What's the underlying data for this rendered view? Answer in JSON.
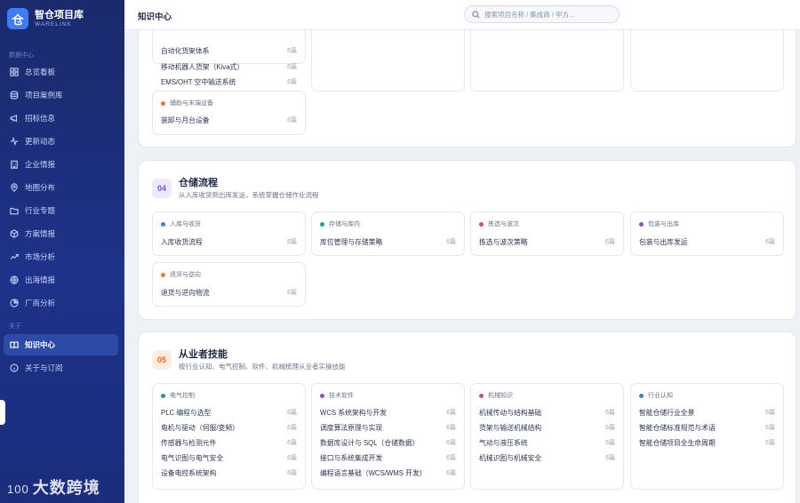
{
  "brand": {
    "logo": "仓",
    "name": "智仓项目库",
    "sub": "WARELINK"
  },
  "sidebar": {
    "group1": "数据中心",
    "group2": "关于",
    "items": [
      {
        "label": "总览看板",
        "icon": "dashboard-icon"
      },
      {
        "label": "项目案例库",
        "icon": "database-icon"
      },
      {
        "label": "招标信息",
        "icon": "megaphone-icon"
      },
      {
        "label": "更新动态",
        "icon": "activity-icon"
      },
      {
        "label": "企业情报",
        "icon": "building-icon"
      },
      {
        "label": "地图分布",
        "icon": "map-pin-icon"
      },
      {
        "label": "行业专题",
        "icon": "folder-icon"
      },
      {
        "label": "方案情报",
        "icon": "cube-icon"
      },
      {
        "label": "市场分析",
        "icon": "trend-icon"
      },
      {
        "label": "出海情报",
        "icon": "globe-icon"
      },
      {
        "label": "厂商分析",
        "icon": "pie-icon"
      }
    ],
    "items2": [
      {
        "label": "知识中心",
        "icon": "book-icon",
        "active": true
      },
      {
        "label": "关于与订阅",
        "icon": "info-icon"
      }
    ],
    "watermark_prefix": "100",
    "watermark": "大数跨境"
  },
  "header": {
    "title": "知识中心",
    "search_placeholder": "搜索项目名称 / 集成商 / 甲方..."
  },
  "colors": {
    "accent": "#3d7bff",
    "sidebar": "#1e3288",
    "orange": "#f07a2a",
    "teal": "#1ba39c",
    "pink": "#e0457b",
    "purple": "#8a4fd6",
    "blue": "#3d7bff",
    "green": "#22a06b"
  },
  "section_top": {
    "card1_rows": [
      {
        "label": "自动化货架体系",
        "count": "6篇"
      },
      {
        "label": "移动机器人货架（Kiva式）",
        "count": "6篇"
      },
      {
        "label": "EMS/OHT 空中输送系统",
        "count": "6篇"
      }
    ],
    "card2": {
      "category": "辅助与末端设备",
      "rows": [
        {
          "label": "装卸与月台设备",
          "count": "6篇"
        }
      ]
    }
  },
  "section4": {
    "num": "04",
    "title": "仓储流程",
    "desc": "从入库收货到出库发运，系统掌握仓储作业流程",
    "cards": [
      {
        "category": "入库与收货",
        "rows": [
          {
            "label": "入库收货流程",
            "count": "6篇"
          }
        ]
      },
      {
        "category": "存储与库内",
        "rows": [
          {
            "label": "库位管理与存储策略",
            "count": "6篇"
          }
        ]
      },
      {
        "category": "拣选与波次",
        "rows": [
          {
            "label": "拣选与波次策略",
            "count": "6篇"
          }
        ]
      },
      {
        "category": "包装与出库",
        "rows": [
          {
            "label": "包装与出库发运",
            "count": "6篇"
          }
        ]
      },
      {
        "category": "退货与逆向",
        "rows": [
          {
            "label": "退货与逆向物流",
            "count": "6篇"
          }
        ]
      }
    ]
  },
  "section5": {
    "num": "05",
    "title": "从业者技能",
    "desc": "按行业认知、电气控制、软件、机械梳理从业者实操技能",
    "cards": [
      {
        "category": "电气控制",
        "rows": [
          {
            "label": "PLC 编程与选型",
            "count": "6篇"
          },
          {
            "label": "电机与驱动（伺服/变频）",
            "count": "6篇"
          },
          {
            "label": "传感器与检测元件",
            "count": "6篇"
          },
          {
            "label": "电气识图与电气安全",
            "count": "6篇"
          },
          {
            "label": "设备电控系统架构",
            "count": "6篇"
          }
        ]
      },
      {
        "category": "技术软件",
        "rows": [
          {
            "label": "WCS 系统架构与开发",
            "count": "6篇"
          },
          {
            "label": "调度算法原理与实现",
            "count": "6篇"
          },
          {
            "label": "数据库设计与 SQL（仓储数据）",
            "count": "6篇"
          },
          {
            "label": "接口与系统集成开发",
            "count": "6篇"
          },
          {
            "label": "编程语言基础（WCS/WMS 开发）",
            "count": "6篇"
          }
        ]
      },
      {
        "category": "机械知识",
        "rows": [
          {
            "label": "机械传动与结构基础",
            "count": "6篇"
          },
          {
            "label": "货架与输送机械结构",
            "count": "6篇"
          },
          {
            "label": "气动与液压系统",
            "count": "6篇"
          },
          {
            "label": "机械识图与机械安全",
            "count": "6篇"
          }
        ]
      },
      {
        "category": "行业认知",
        "rows": [
          {
            "label": "智能仓储行业全景",
            "count": "6篇"
          },
          {
            "label": "智能仓储标准规范与术语",
            "count": "6篇"
          },
          {
            "label": "智能仓储项目全生命周期",
            "count": "6篇"
          }
        ]
      }
    ]
  }
}
